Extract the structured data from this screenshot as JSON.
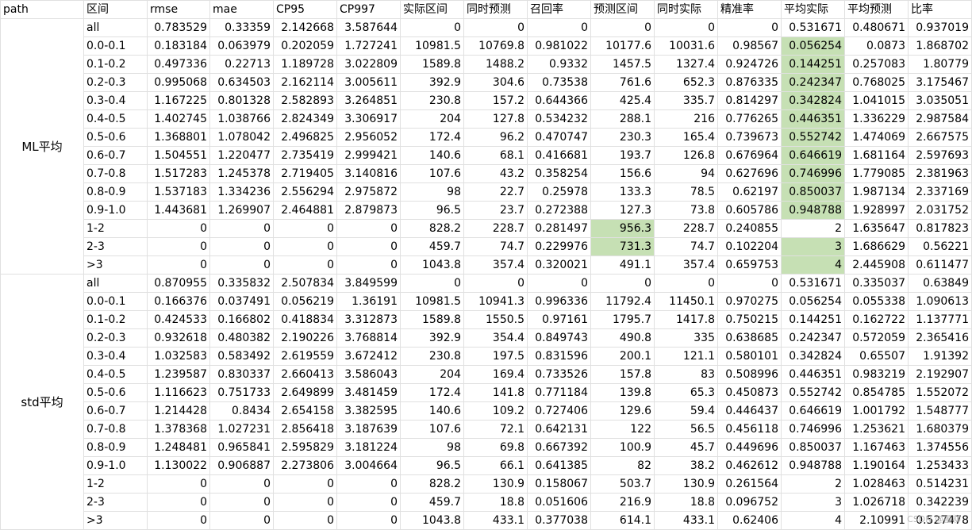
{
  "headers": [
    "path",
    "区间",
    "rmse",
    "mae",
    "CP95",
    "CP997",
    "实际区间",
    "同时预测",
    "召回率",
    "预测区间",
    "同时实际",
    "精准率",
    "平均实际",
    "平均预测",
    "比率"
  ],
  "highlight_color": "#c6e0b4",
  "groups": [
    {
      "label": "ML平均",
      "rows": [
        [
          "all",
          "0.783529",
          "0.33359",
          "2.142668",
          "3.587644",
          "0",
          "0",
          "0",
          "0",
          "0",
          "0",
          "0.531671",
          "0.480671",
          "0.937019"
        ],
        [
          "0.0-0.1",
          "0.183184",
          "0.063979",
          "0.202059",
          "1.727241",
          "10981.5",
          "10769.8",
          "0.981022",
          "10177.6",
          "10031.6",
          "0.98567",
          "0.056254",
          "0.0873",
          "1.868702"
        ],
        [
          "0.1-0.2",
          "0.497336",
          "0.22713",
          "1.189728",
          "3.022809",
          "1589.8",
          "1488.2",
          "0.9332",
          "1457.5",
          "1327.4",
          "0.924726",
          "0.144251",
          "0.257083",
          "1.80779"
        ],
        [
          "0.2-0.3",
          "0.995068",
          "0.634503",
          "2.162114",
          "3.005611",
          "392.9",
          "304.6",
          "0.73538",
          "761.6",
          "652.3",
          "0.876335",
          "0.242347",
          "0.768025",
          "3.175467"
        ],
        [
          "0.3-0.4",
          "1.167225",
          "0.801328",
          "2.582893",
          "3.264851",
          "230.8",
          "157.2",
          "0.644366",
          "425.4",
          "335.7",
          "0.814297",
          "0.342824",
          "1.041015",
          "3.035051"
        ],
        [
          "0.4-0.5",
          "1.402745",
          "1.038766",
          "2.824349",
          "3.306917",
          "204",
          "127.8",
          "0.534232",
          "288.1",
          "216",
          "0.776265",
          "0.446351",
          "1.336229",
          "2.987584"
        ],
        [
          "0.5-0.6",
          "1.368801",
          "1.078042",
          "2.496825",
          "2.956052",
          "172.4",
          "96.2",
          "0.470747",
          "230.3",
          "165.4",
          "0.739673",
          "0.552742",
          "1.474069",
          "2.667575"
        ],
        [
          "0.6-0.7",
          "1.504551",
          "1.220477",
          "2.735419",
          "2.999421",
          "140.6",
          "68.1",
          "0.416681",
          "193.7",
          "126.8",
          "0.676964",
          "0.646619",
          "1.681164",
          "2.597693"
        ],
        [
          "0.7-0.8",
          "1.517283",
          "1.245378",
          "2.719405",
          "3.140816",
          "107.6",
          "43.2",
          "0.358254",
          "156.6",
          "94",
          "0.627696",
          "0.746996",
          "1.779085",
          "2.381963"
        ],
        [
          "0.8-0.9",
          "1.537183",
          "1.334236",
          "2.556294",
          "2.975872",
          "98",
          "22.7",
          "0.25978",
          "133.3",
          "78.5",
          "0.62197",
          "0.850037",
          "1.987134",
          "2.337169"
        ],
        [
          "0.9-1.0",
          "1.443681",
          "1.269907",
          "2.464881",
          "2.879873",
          "96.5",
          "23.7",
          "0.272388",
          "127.3",
          "73.8",
          "0.605786",
          "0.948788",
          "1.928997",
          "2.031752"
        ],
        [
          "1-2",
          "0",
          "0",
          "0",
          "0",
          "828.2",
          "228.7",
          "0.281497",
          "956.3",
          "228.7",
          "0.240855",
          "2",
          "1.635647",
          "0.817823"
        ],
        [
          "2-3",
          "0",
          "0",
          "0",
          "0",
          "459.7",
          "74.7",
          "0.229976",
          "731.3",
          "74.7",
          "0.102204",
          "3",
          "1.686629",
          "0.56221"
        ],
        [
          ">3",
          "0",
          "0",
          "0",
          "0",
          "1043.8",
          "357.4",
          "0.320021",
          "491.1",
          "357.4",
          "0.659753",
          "4",
          "2.445908",
          "0.611477"
        ]
      ],
      "highlights": [
        [
          1,
          11
        ],
        [
          2,
          11
        ],
        [
          3,
          11
        ],
        [
          4,
          11
        ],
        [
          5,
          11
        ],
        [
          6,
          11
        ],
        [
          7,
          11
        ],
        [
          8,
          11
        ],
        [
          9,
          11
        ],
        [
          10,
          11
        ],
        [
          11,
          8
        ],
        [
          12,
          8
        ],
        [
          12,
          11
        ],
        [
          13,
          11
        ]
      ]
    },
    {
      "label": "std平均",
      "rows": [
        [
          "all",
          "0.870955",
          "0.335832",
          "2.507834",
          "3.849599",
          "0",
          "0",
          "0",
          "0",
          "0",
          "0",
          "0.531671",
          "0.335037",
          "0.63849"
        ],
        [
          "0.0-0.1",
          "0.166376",
          "0.037491",
          "0.056219",
          "1.36191",
          "10981.5",
          "10941.3",
          "0.996336",
          "11792.4",
          "11450.1",
          "0.970275",
          "0.056254",
          "0.055338",
          "1.090613"
        ],
        [
          "0.1-0.2",
          "0.424533",
          "0.166802",
          "0.418834",
          "3.312873",
          "1589.8",
          "1550.5",
          "0.97161",
          "1795.7",
          "1417.8",
          "0.750215",
          "0.144251",
          "0.162722",
          "1.137771"
        ],
        [
          "0.2-0.3",
          "0.932618",
          "0.480382",
          "2.190226",
          "3.768814",
          "392.9",
          "354.4",
          "0.849743",
          "490.8",
          "335",
          "0.638685",
          "0.242347",
          "0.572059",
          "2.365416"
        ],
        [
          "0.3-0.4",
          "1.032583",
          "0.583492",
          "2.619559",
          "3.672412",
          "230.8",
          "197.5",
          "0.831596",
          "200.1",
          "121.1",
          "0.580101",
          "0.342824",
          "0.65507",
          "1.91392"
        ],
        [
          "0.4-0.5",
          "1.239587",
          "0.830337",
          "2.660413",
          "3.586043",
          "204",
          "169.4",
          "0.733526",
          "157.8",
          "83",
          "0.508996",
          "0.446351",
          "0.983219",
          "2.192907"
        ],
        [
          "0.5-0.6",
          "1.116623",
          "0.751733",
          "2.649899",
          "3.481459",
          "172.4",
          "141.8",
          "0.771184",
          "139.8",
          "65.3",
          "0.450873",
          "0.552742",
          "0.854785",
          "1.552072"
        ],
        [
          "0.6-0.7",
          "1.214428",
          "0.8434",
          "2.654158",
          "3.382595",
          "140.6",
          "109.2",
          "0.727406",
          "129.6",
          "59.4",
          "0.446437",
          "0.646619",
          "1.001792",
          "1.548777"
        ],
        [
          "0.7-0.8",
          "1.378368",
          "1.027231",
          "2.856418",
          "3.187639",
          "107.6",
          "72.1",
          "0.642131",
          "122",
          "56.5",
          "0.456118",
          "0.746996",
          "1.253621",
          "1.680379"
        ],
        [
          "0.8-0.9",
          "1.248481",
          "0.965841",
          "2.595829",
          "3.181224",
          "98",
          "69.8",
          "0.667392",
          "100.9",
          "45.7",
          "0.449696",
          "0.850037",
          "1.167463",
          "1.374556"
        ],
        [
          "0.9-1.0",
          "1.130022",
          "0.906887",
          "2.273806",
          "3.004664",
          "96.5",
          "66.1",
          "0.641385",
          "82",
          "38.2",
          "0.462612",
          "0.948788",
          "1.190164",
          "1.253433"
        ],
        [
          "1-2",
          "0",
          "0",
          "0",
          "0",
          "828.2",
          "130.9",
          "0.158067",
          "503.7",
          "130.9",
          "0.261564",
          "2",
          "1.028463",
          "0.514231"
        ],
        [
          "2-3",
          "0",
          "0",
          "0",
          "0",
          "459.7",
          "18.8",
          "0.051606",
          "216.9",
          "18.8",
          "0.096752",
          "3",
          "1.026718",
          "0.342239"
        ],
        [
          ">3",
          "0",
          "0",
          "0",
          "0",
          "1043.8",
          "433.1",
          "0.377038",
          "614.1",
          "433.1",
          "0.62406",
          "4",
          "2.10991",
          "0.527478"
        ]
      ],
      "highlights": []
    }
  ],
  "watermark": "CSDN @墨柳"
}
